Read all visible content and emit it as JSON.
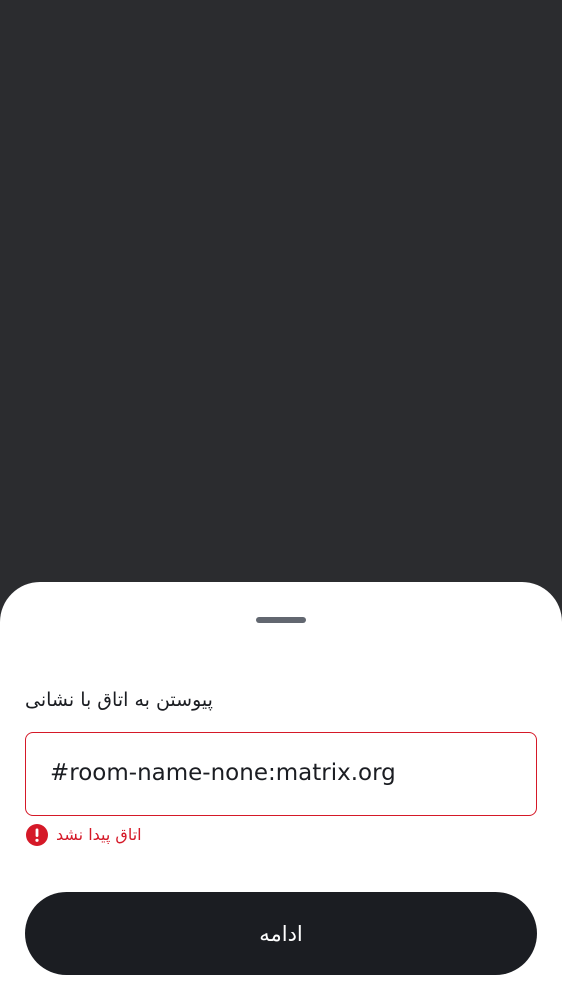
{
  "sheet": {
    "field_label": "پیوستن به اتاق با نشانی",
    "address_input_value": "#room-name-none:matrix.org",
    "error_message": "اتاق پیدا نشد",
    "error_icon": "error-exclamation-icon",
    "continue_label": "ادامه"
  },
  "colors": {
    "background_scrim": "#2b2c2f",
    "sheet": "#ffffff",
    "error": "#d51928",
    "button": "#1b1d22",
    "button_text": "#ffffff",
    "handle": "#626770"
  }
}
